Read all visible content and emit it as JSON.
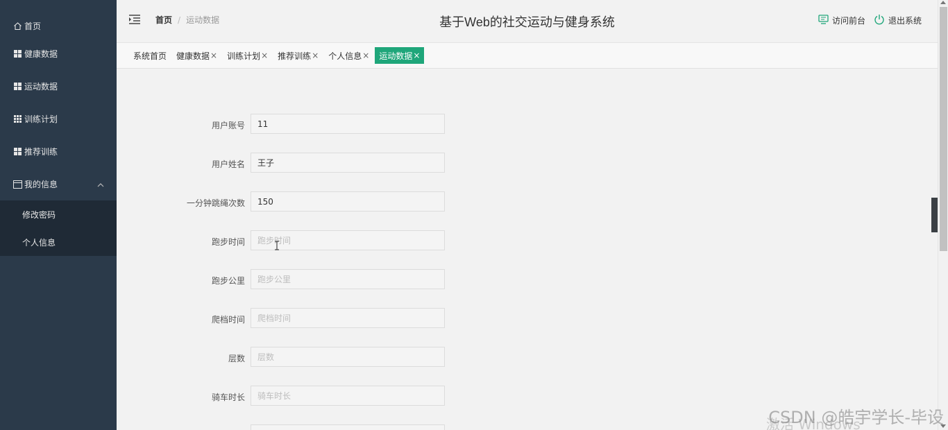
{
  "sidebar": {
    "items": [
      {
        "label": "首页",
        "icon": "home-icon"
      },
      {
        "label": "健康数据",
        "icon": "grid-icon"
      },
      {
        "label": "运动数据",
        "icon": "grid-icon"
      },
      {
        "label": "训练计划",
        "icon": "table-grid-icon"
      },
      {
        "label": "推荐训练",
        "icon": "grid-icon"
      },
      {
        "label": "我的信息",
        "icon": "window-icon",
        "expanded": true,
        "children": [
          {
            "label": "修改密码"
          },
          {
            "label": "个人信息"
          }
        ]
      }
    ]
  },
  "header": {
    "breadcrumb_home": "首页",
    "breadcrumb_sep": "/",
    "breadcrumb_current": "运动数据",
    "title": "基于Web的社交运动与健身系统",
    "visit_front": "访问前台",
    "logout": "退出系统"
  },
  "tabs": [
    {
      "label": "系统首页",
      "closable": false
    },
    {
      "label": "健康数据",
      "closable": true
    },
    {
      "label": "训练计划",
      "closable": true
    },
    {
      "label": "推荐训练",
      "closable": true
    },
    {
      "label": "个人信息",
      "closable": true
    },
    {
      "label": "运动数据",
      "closable": true,
      "active": true
    }
  ],
  "form": {
    "fields": [
      {
        "label": "用户账号",
        "value": "11",
        "placeholder": ""
      },
      {
        "label": "用户姓名",
        "value": "王子",
        "placeholder": ""
      },
      {
        "label": "一分钟跳绳次数",
        "value": "150",
        "placeholder": ""
      },
      {
        "label": "跑步时间",
        "value": "",
        "placeholder": "跑步时间"
      },
      {
        "label": "跑步公里",
        "value": "",
        "placeholder": "跑步公里"
      },
      {
        "label": "爬档时间",
        "value": "",
        "placeholder": "爬档时间"
      },
      {
        "label": "层数",
        "value": "",
        "placeholder": "层数"
      },
      {
        "label": "骑车时长",
        "value": "",
        "placeholder": "骑车时长"
      }
    ]
  },
  "tab_close_glyph": "×",
  "watermark": {
    "csdn": "CSDN @皓宇学长-毕设",
    "windows": "激活 Windows"
  },
  "colors": {
    "sidebar_bg": "#2b3a4a",
    "sidebar_sub_bg": "#1f2a36",
    "active_tab": "#1fa67a",
    "accent_icon": "#1fa67a"
  }
}
